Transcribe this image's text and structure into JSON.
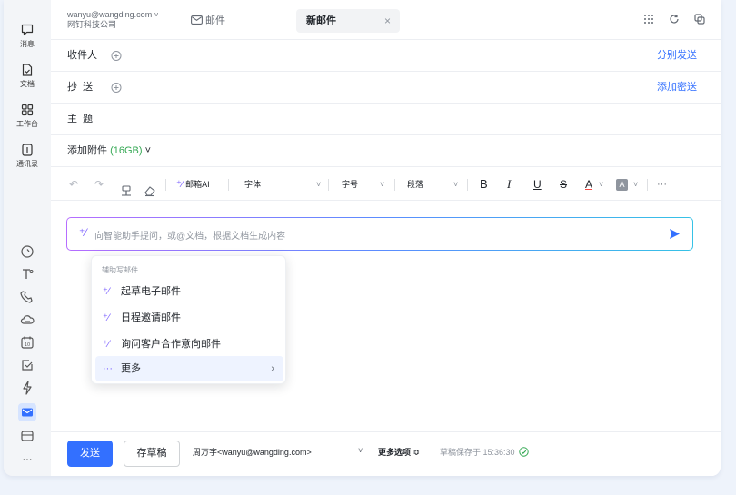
{
  "rail": {
    "items": [
      {
        "label": "消息",
        "icon": "message-icon"
      },
      {
        "label": "文档",
        "icon": "document-icon"
      },
      {
        "label": "工作台",
        "icon": "workbench-icon"
      },
      {
        "label": "通讯录",
        "icon": "contacts-icon"
      }
    ],
    "bottom_icons": [
      "at-icon",
      "spread-icon",
      "phone-icon",
      "cloud-icon",
      "calendar-icon",
      "task-icon",
      "lightning-icon",
      "mail-icon",
      "folder-icon",
      "more-icon"
    ],
    "more_label": "···"
  },
  "account": {
    "email": "wanyu@wangding.com",
    "org": "网钉科技公司"
  },
  "tabs": {
    "mail_label": "邮件",
    "new_label": "新邮件",
    "close": "×"
  },
  "fields": {
    "to_label": "收件人",
    "to_link": "分别发送",
    "cc_label": "抄  送",
    "cc_link": "添加密送",
    "subject_label": "主  题",
    "attach_label": "添加附件",
    "attach_size": "(16GB)",
    "attach_chevron": "˅"
  },
  "toolbar": {
    "ai": "邮箱AI",
    "font": "字体",
    "size": "字号",
    "paragraph": "段落",
    "bold": "B",
    "italic": "I",
    "underline": "U",
    "strike": "S",
    "font_color": "A",
    "highlight": "A",
    "more": "···",
    "chevron": "˅"
  },
  "ai_input": {
    "placeholder": "向智能助手提问，或@文档，根据文档生成内容"
  },
  "menu": {
    "title": "辅助写邮件",
    "items": [
      {
        "label": "起草电子邮件"
      },
      {
        "label": "日程邀请邮件"
      },
      {
        "label": "询问客户合作意向邮件"
      },
      {
        "label": "更多",
        "icon_text": "···",
        "arrow": "›"
      }
    ]
  },
  "footer": {
    "send_label": "发送",
    "draft_label": "存草稿",
    "sender": "周万宇<wanyu@wangding.com>",
    "sender_chevron": "˅",
    "more_options": "更多选项 ≎",
    "saved_status": "草稿保存于 15:36:30"
  },
  "colors": {
    "accent": "#3370ff",
    "green": "#34a853",
    "ai_gradient_start": "#b66dff"
  }
}
